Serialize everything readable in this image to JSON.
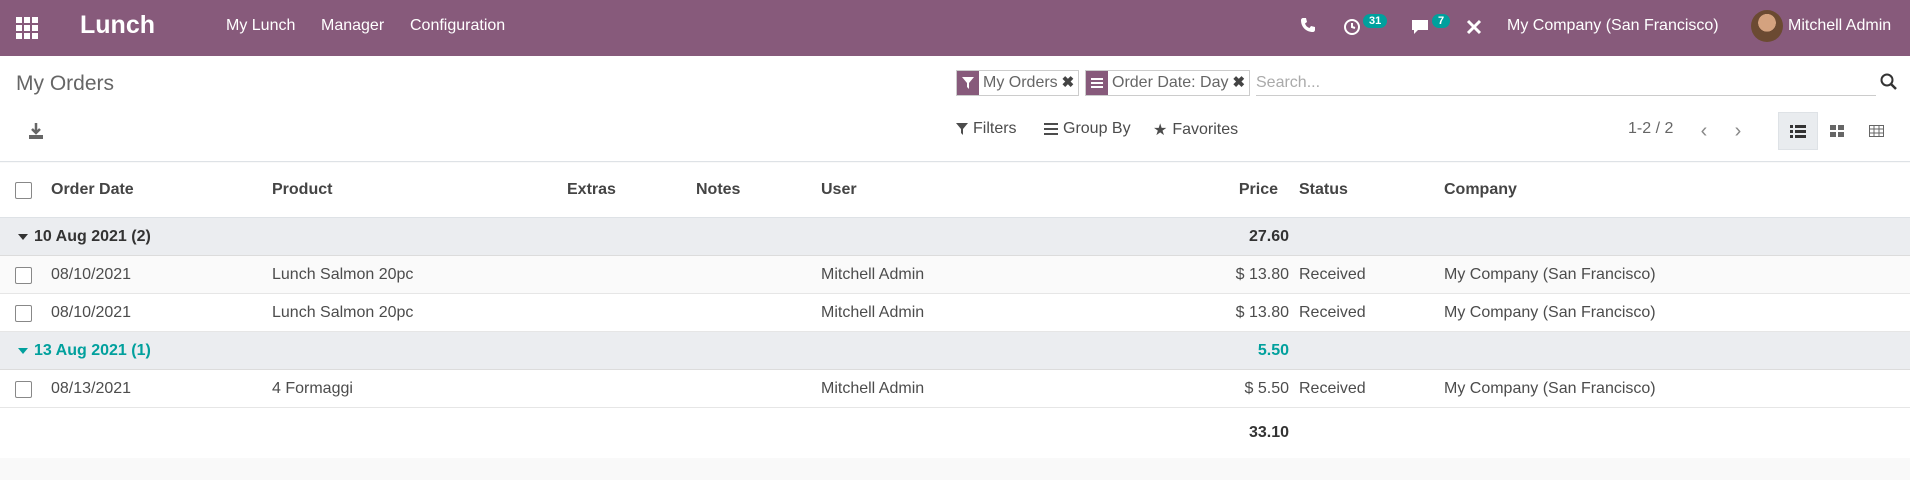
{
  "navbar": {
    "brand": "Lunch",
    "menus": [
      "My Lunch",
      "Manager",
      "Configuration"
    ],
    "activity_count": "31",
    "message_count": "7",
    "company": "My Company (San Francisco)",
    "user": "Mitchell Admin",
    "accent": "#875a7b"
  },
  "control_panel": {
    "title": "My Orders",
    "facets": [
      {
        "label": "My Orders",
        "icon": "filter-icon"
      },
      {
        "label": "Order Date: Day",
        "icon": "groupby-icon"
      }
    ],
    "search_placeholder": "Search...",
    "filters_label": "Filters",
    "groupby_label": "Group By",
    "favorites_label": "Favorites",
    "pager": "1-2 / 2"
  },
  "table": {
    "columns": {
      "order_date": "Order Date",
      "product": "Product",
      "extras": "Extras",
      "notes": "Notes",
      "user": "User",
      "price": "Price",
      "status": "Status",
      "company": "Company"
    },
    "groups": [
      {
        "label": "10 Aug 2021 (2)",
        "total": "27.60",
        "rows": [
          {
            "date": "08/10/2021",
            "product": "Lunch Salmon 20pc",
            "user": "Mitchell Admin",
            "price": "$ 13.80",
            "status": "Received",
            "company": "My Company (San Francisco)"
          },
          {
            "date": "08/10/2021",
            "product": "Lunch Salmon 20pc",
            "user": "Mitchell Admin",
            "price": "$ 13.80",
            "status": "Received",
            "company": "My Company (San Francisco)"
          }
        ]
      },
      {
        "label": "13 Aug 2021 (1)",
        "total": "5.50",
        "rows": [
          {
            "date": "08/13/2021",
            "product": "4 Formaggi",
            "user": "Mitchell Admin",
            "price": "$ 5.50",
            "status": "Received",
            "company": "My Company (San Francisco)"
          }
        ]
      }
    ],
    "grand_total": "33.10"
  }
}
